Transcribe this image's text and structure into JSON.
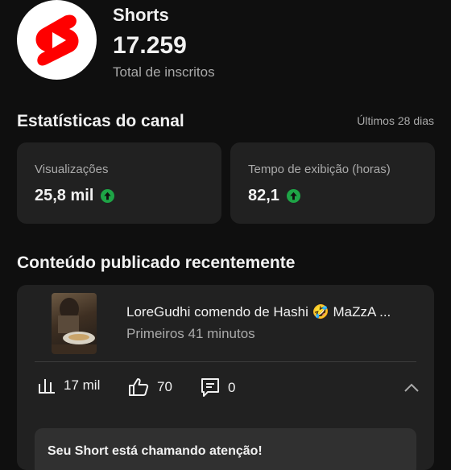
{
  "channel": {
    "name": "Shorts",
    "subscriber_count": "17.259",
    "subscriber_label": "Total de inscritos",
    "logo_icon": "youtube-shorts-logo",
    "brand_color": "#ff0000"
  },
  "stats": {
    "title": "Estatísticas do canal",
    "period": "Últimos 28 dias",
    "cards": [
      {
        "label": "Visualizações",
        "value": "25,8 mil",
        "trend_icon": "arrow-up-circle-icon",
        "trend_color": "#1ea446"
      },
      {
        "label": "Tempo de exibição (horas)",
        "value": "82,1",
        "trend_icon": "arrow-up-circle-icon",
        "trend_color": "#1ea446"
      }
    ]
  },
  "recent": {
    "title": "Conteúdo publicado recentemente",
    "video": {
      "title": "LoreGudhi comendo de Hashi 🤣 MaZzA ...",
      "meta": "Primeiros 41 minutos",
      "views": "17 mil",
      "likes": "70",
      "comments": "0"
    },
    "notice": "Seu Short está chamando atenção!"
  }
}
